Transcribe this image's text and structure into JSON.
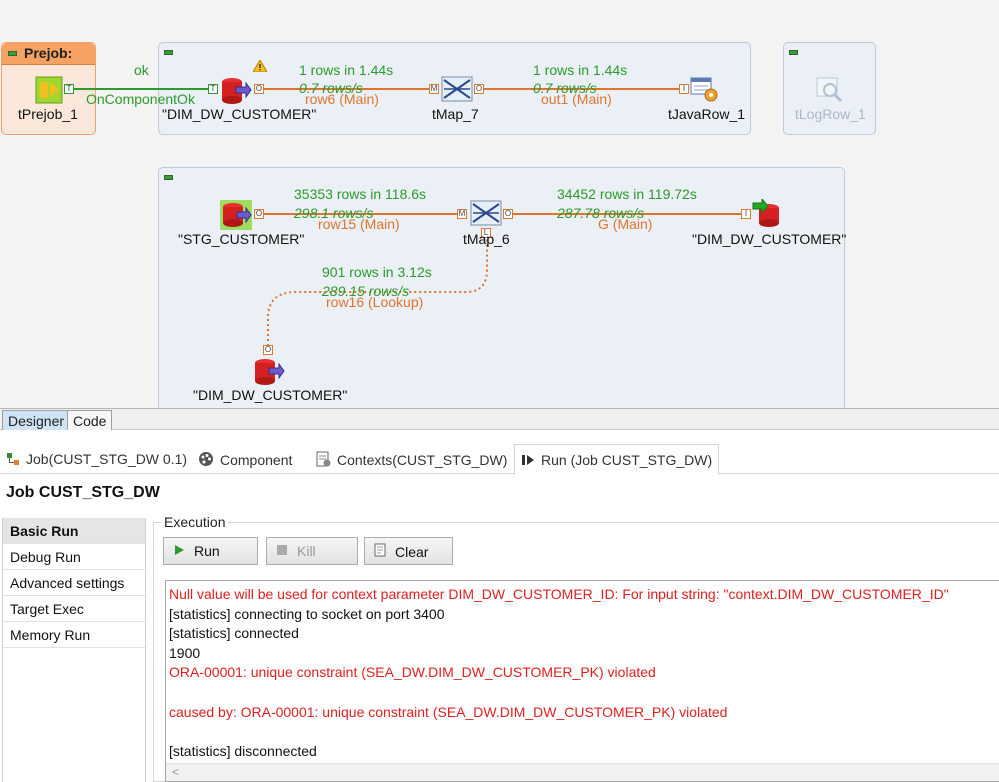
{
  "canvas": {
    "prejob": {
      "title": "Prejob:",
      "component": "tPrejob_1"
    },
    "trigger": {
      "ok": "ok",
      "on_component_ok": "OnComponentOk"
    },
    "subjob1": {
      "input": "\"DIM_DW_CUSTOMER\"",
      "map": "tMap_7",
      "output": "tJavaRow_1",
      "log": "tLogRow_1",
      "flow1": {
        "rows": "1 rows in 1.44s",
        "rate": "0.7 rows/s",
        "name": "row6 (Main)"
      },
      "flow2": {
        "rows": "1 rows in 1.44s",
        "rate": "0.7 rows/s",
        "name": "out1 (Main)"
      }
    },
    "subjob2": {
      "input": "\"STG_CUSTOMER\"",
      "map": "tMap_6",
      "output": "\"DIM_DW_CUSTOMER\"",
      "lookup_input": "\"DIM_DW_CUSTOMER\"",
      "flow1": {
        "rows": "35353 rows in 118.6s",
        "rate": "298.1 rows/s",
        "name": "row15 (Main)"
      },
      "flow2": {
        "rows": "34452 rows in 119.72s",
        "rate": "287.78 rows/s",
        "name": "G (Main)"
      },
      "lookup": {
        "rows": "901 rows in 3.12s",
        "rate": "289.15 rows/s",
        "name": "row16 (Lookup)"
      }
    },
    "colors": {
      "main_flow": "#e0742c",
      "trigger": "#2c9a2c",
      "stats": "#2c9a2c"
    }
  },
  "editor_tabs": [
    "Designer",
    "Code"
  ],
  "view_tabs": [
    {
      "label": "Job(CUST_STG_DW 0.1)",
      "icon": "job-icon"
    },
    {
      "label": "Component",
      "icon": "palette-icon"
    },
    {
      "label": "Contexts(CUST_STG_DW)",
      "icon": "contexts-icon"
    },
    {
      "label": "Run (Job CUST_STG_DW)",
      "icon": "run-view-icon"
    }
  ],
  "job_title": "Job CUST_STG_DW",
  "run_nav": [
    "Basic Run",
    "Debug Run",
    "Advanced settings",
    "Target Exec",
    "Memory Run"
  ],
  "execution": {
    "legend": "Execution",
    "buttons": {
      "run": "Run",
      "kill": "Kill",
      "clear": "Clear"
    }
  },
  "console": [
    {
      "text": "Null value will be used for context parameter DIM_DW_CUSTOMER_ID: For input string: \"context.DIM_DW_CUSTOMER_ID\"",
      "type": "err"
    },
    {
      "text": "[statistics] connecting to socket on port 3400",
      "type": "info"
    },
    {
      "text": "[statistics] connected",
      "type": "info"
    },
    {
      "text": "1900",
      "type": "info"
    },
    {
      "text": "ORA-00001: unique constraint (SEA_DW.DIM_DW_CUSTOMER_PK) violated",
      "type": "err"
    },
    {
      "text": "",
      "type": "info"
    },
    {
      "text": "caused by: ORA-00001: unique constraint (SEA_DW.DIM_DW_CUSTOMER_PK) violated",
      "type": "err"
    },
    {
      "text": "",
      "type": "info"
    },
    {
      "text": "[statistics] disconnected",
      "type": "info"
    }
  ]
}
